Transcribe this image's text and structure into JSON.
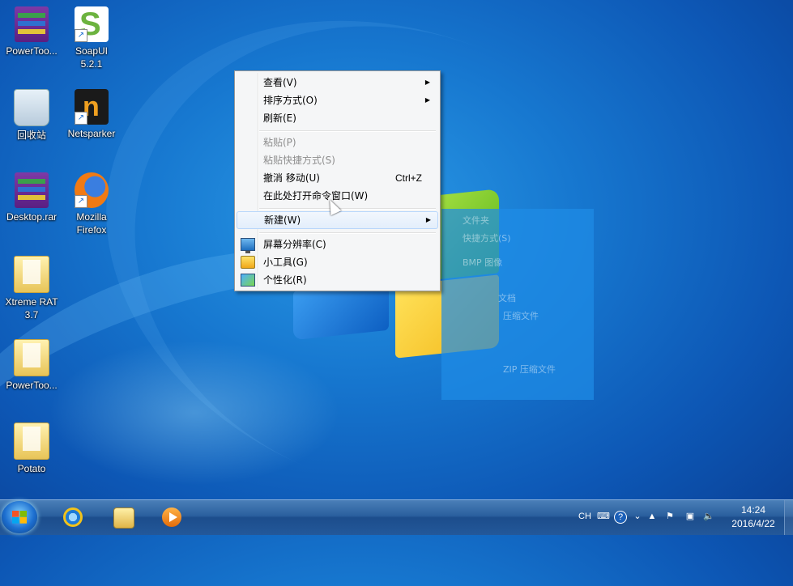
{
  "desktop": {
    "icons": [
      {
        "label": "PowerToo...",
        "icon": "winrar-archive-icon"
      },
      {
        "label": "SoapUI\n5.2.1",
        "icon": "soapui-icon"
      },
      {
        "label": "回收站",
        "icon": "recycle-bin-icon"
      },
      {
        "label": "Netsparker",
        "icon": "netsparker-icon"
      },
      {
        "label": "Desktop.rar",
        "icon": "winrar-archive-icon"
      },
      {
        "label": "Mozilla\nFirefox",
        "icon": "firefox-icon"
      },
      {
        "label": "Xtreme RAT\n3.7",
        "icon": "folder-icon"
      },
      {
        "label": "PowerToo...",
        "icon": "folder-icon"
      },
      {
        "label": "Potato",
        "icon": "folder-icon"
      }
    ],
    "ghost_submenu": [
      "文件夹",
      "快捷方式(S)",
      "BMP 图像",
      "文档",
      "压缩文件",
      "ZIP 压缩文件"
    ]
  },
  "context_menu": {
    "items": [
      {
        "label": "查看(V)",
        "submenu": true
      },
      {
        "label": "排序方式(O)",
        "submenu": true
      },
      {
        "label": "刷新(E)"
      },
      {
        "label": "粘贴(P)",
        "disabled": true
      },
      {
        "label": "粘贴快捷方式(S)",
        "disabled": true
      },
      {
        "label": "撤消 移动(U)",
        "shortcut": "Ctrl+Z"
      },
      {
        "label": "在此处打开命令窗口(W)"
      },
      {
        "label": "新建(W)",
        "submenu": true,
        "highlighted": true
      },
      {
        "label": "屏幕分辨率(C)",
        "icon": "monitor-icon"
      },
      {
        "label": "小工具(G)",
        "icon": "gadgets-icon"
      },
      {
        "label": "个性化(R)",
        "icon": "personalize-icon"
      }
    ],
    "submenu_arrow": "▶"
  },
  "taskbar": {
    "pinned": [
      "internet-explorer-icon",
      "file-explorer-icon",
      "media-player-icon"
    ],
    "tray": {
      "language": "CH",
      "time": "14:24",
      "date": "2016/4/22"
    }
  },
  "colors": {
    "desktop_blue": "#1778d0",
    "menu_bg": "#f5f6f7",
    "menu_highlight": "#e3eefb"
  }
}
